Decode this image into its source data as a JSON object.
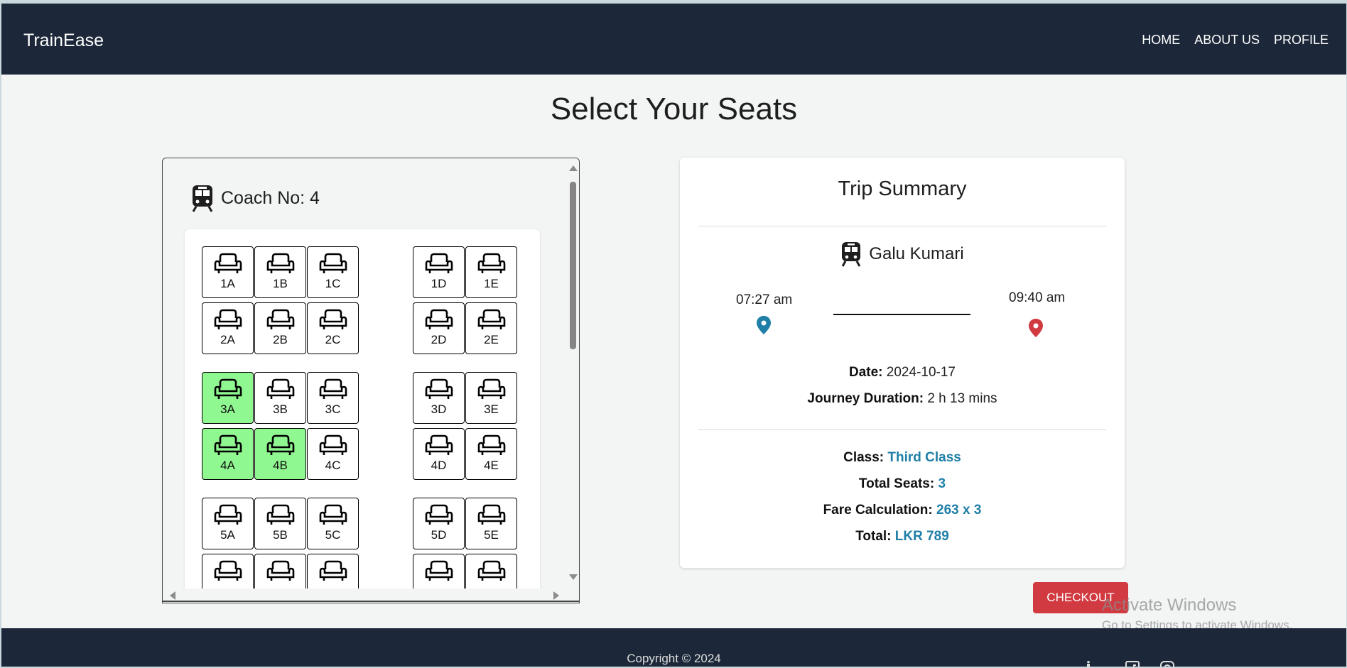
{
  "navbar": {
    "brand": "TrainEase",
    "links": [
      "HOME",
      "ABOUT US",
      "PROFILE"
    ]
  },
  "page": {
    "title": "Select Your Seats"
  },
  "coach": {
    "label": "Coach No: 4",
    "seats": [
      {
        "label": "1A",
        "selected": false
      },
      {
        "label": "1B",
        "selected": false
      },
      {
        "label": "1C",
        "selected": false
      },
      {
        "label": "1D",
        "selected": false
      },
      {
        "label": "1E",
        "selected": false
      },
      {
        "label": "2A",
        "selected": false
      },
      {
        "label": "2B",
        "selected": false
      },
      {
        "label": "2C",
        "selected": false
      },
      {
        "label": "2D",
        "selected": false
      },
      {
        "label": "2E",
        "selected": false
      },
      {
        "label": "3A",
        "selected": true
      },
      {
        "label": "3B",
        "selected": false
      },
      {
        "label": "3C",
        "selected": false
      },
      {
        "label": "3D",
        "selected": false
      },
      {
        "label": "3E",
        "selected": false
      },
      {
        "label": "4A",
        "selected": true
      },
      {
        "label": "4B",
        "selected": true
      },
      {
        "label": "4C",
        "selected": false
      },
      {
        "label": "4D",
        "selected": false
      },
      {
        "label": "4E",
        "selected": false
      },
      {
        "label": "5A",
        "selected": false
      },
      {
        "label": "5B",
        "selected": false
      },
      {
        "label": "5C",
        "selected": false
      },
      {
        "label": "5D",
        "selected": false
      },
      {
        "label": "5E",
        "selected": false
      },
      {
        "label": "",
        "selected": false
      },
      {
        "label": "",
        "selected": false
      },
      {
        "label": "",
        "selected": false
      },
      {
        "label": "",
        "selected": false
      },
      {
        "label": "",
        "selected": false
      }
    ],
    "selected_color": "#90f890"
  },
  "summary": {
    "title": "Trip Summary",
    "train_name": "Galu Kumari",
    "departure_time": "07:27 am",
    "arrival_time": "09:40 am",
    "date_label": "Date:",
    "date_value": "2024-10-17",
    "duration_label": "Journey Duration:",
    "duration_value": "2 h 13 mins",
    "class_label": "Class:",
    "class_value": "Third Class",
    "seats_label": "Total Seats:",
    "seats_value": "3",
    "fare_label": "Fare Calculation:",
    "fare_value": "263 x 3",
    "total_label": "Total:",
    "total_value": "LKR 789",
    "accent_color": "#1f7fa6",
    "origin_pin_color": "#1f7fa6",
    "destination_pin_color": "#d13a40"
  },
  "checkout": {
    "label": "CHECKOUT",
    "color": "#d13a40"
  },
  "watermark": {
    "title": "Activate Windows",
    "subtitle": "Go to Settings to activate Windows."
  },
  "footer": {
    "copyright": "Copyright © 2024"
  },
  "colors": {
    "navbar": "#1c2839",
    "background": "#f3f5f4"
  }
}
